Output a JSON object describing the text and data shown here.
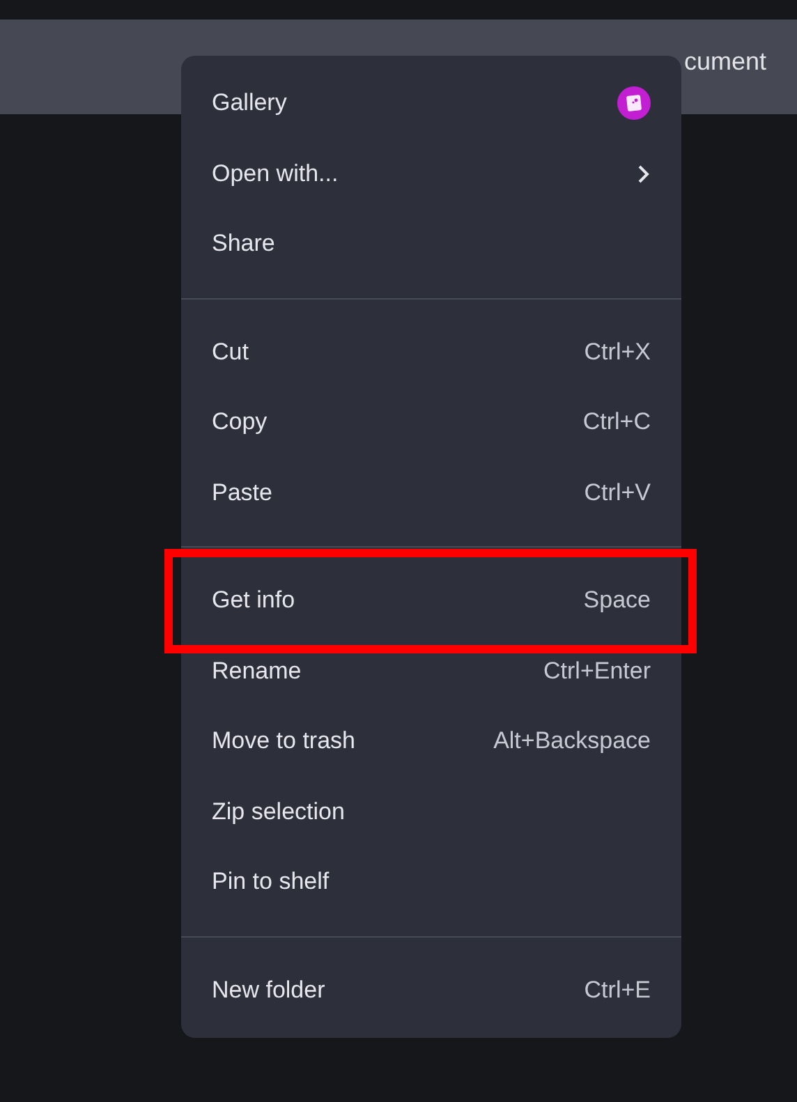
{
  "header": {
    "title": "cument"
  },
  "menu": {
    "sections": [
      {
        "items": [
          {
            "label": "Gallery",
            "kind": "app",
            "highlighted": false
          },
          {
            "label": "Open with...",
            "kind": "submenu",
            "highlighted": false
          },
          {
            "label": "Share",
            "kind": "plain",
            "highlighted": false
          }
        ]
      },
      {
        "items": [
          {
            "label": "Cut",
            "shortcut": "Ctrl+X",
            "kind": "plain",
            "highlighted": false
          },
          {
            "label": "Copy",
            "shortcut": "Ctrl+C",
            "kind": "plain",
            "highlighted": false
          },
          {
            "label": "Paste",
            "shortcut": "Ctrl+V",
            "kind": "plain",
            "highlighted": false
          }
        ]
      },
      {
        "items": [
          {
            "label": "Get info",
            "shortcut": "Space",
            "kind": "plain",
            "highlighted": true
          },
          {
            "label": "Rename",
            "shortcut": "Ctrl+Enter",
            "kind": "plain",
            "highlighted": false
          },
          {
            "label": "Move to trash",
            "shortcut": "Alt+Backspace",
            "kind": "plain",
            "highlighted": false
          },
          {
            "label": "Zip selection",
            "kind": "plain",
            "highlighted": false
          },
          {
            "label": "Pin to shelf",
            "kind": "plain",
            "highlighted": false
          }
        ]
      },
      {
        "items": [
          {
            "label": "New folder",
            "shortcut": "Ctrl+E",
            "kind": "plain",
            "highlighted": false
          }
        ]
      }
    ]
  }
}
